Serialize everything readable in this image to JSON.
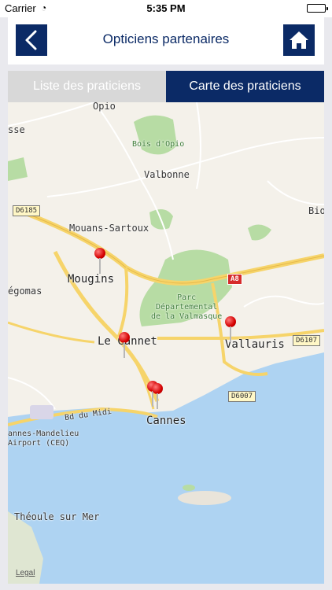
{
  "status": {
    "carrier": "Carrier",
    "time": "5:35 PM"
  },
  "header": {
    "title": "Opticiens partenaires"
  },
  "tabs": {
    "list": "Liste des praticiens",
    "map": "Carte des praticiens"
  },
  "map": {
    "labels": {
      "opio": "Opio",
      "sse": "sse",
      "bois_opio": "Bois d'Opio",
      "valbonne": "Valbonne",
      "bio": "Bio",
      "mouans": "Mouans-Sartoux",
      "mougins": "Mougins",
      "egomas": "égomas",
      "parc": "Parc\nDépartemental\nde la Valmasque",
      "vallauris": "Vallauris",
      "le_cannet": "Le Cannet",
      "cannes": "Cannes",
      "bd_midi": "Bd du Midi",
      "airport": "annes-Mandelieu\nAirport (CEQ)",
      "theoule": "Théoule sur Mer",
      "legal": "Legal"
    },
    "roads": {
      "d6185": "D6185",
      "a8": "A8",
      "d6107": "D6107",
      "d6007": "D6007"
    },
    "pins": [
      "pin-mougins",
      "pin-le-cannet",
      "pin-vallauris",
      "pin-cannes-1",
      "pin-cannes-2"
    ]
  },
  "colors": {
    "brand": "#0b2a66",
    "tab_inactive": "#d8d8d8",
    "sea": "#aed3f2",
    "park": "#b7dca4",
    "road": "#f6d46a"
  }
}
